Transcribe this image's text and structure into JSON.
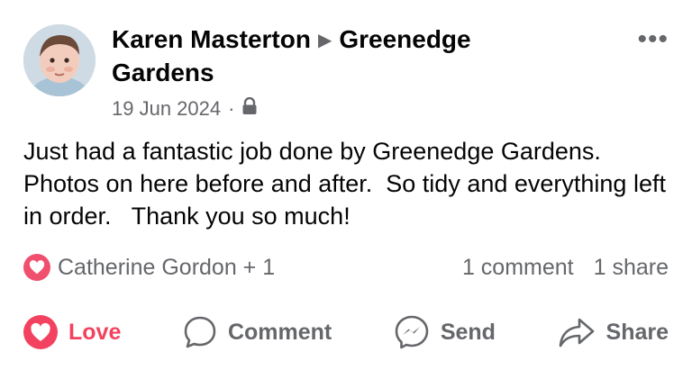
{
  "post": {
    "author": "Karen Masterton",
    "target": "Greenedge Gardens",
    "date": "19 Jun 2024",
    "separator": "·",
    "privacy_icon": "lock-icon",
    "more_icon": "ellipsis-icon",
    "more_label": "•••",
    "text": "Just had a fantastic job done by Greenedge Gardens.  Photos on here before and after.  So tidy and everything left in order.   Thank you so much!"
  },
  "reactions": {
    "icon": "heart-icon",
    "names": "Catherine Gordon + 1",
    "comments": "1 comment",
    "shares": "1 share"
  },
  "actions": [
    {
      "label": "Love",
      "icon": "heart-icon",
      "active": true
    },
    {
      "label": "Comment",
      "icon": "comment-icon",
      "active": false
    },
    {
      "label": "Send",
      "icon": "messenger-icon",
      "active": false
    },
    {
      "label": "Share",
      "icon": "share-icon",
      "active": false
    }
  ],
  "colors": {
    "love": "#f3425f",
    "secondary_text": "#65676b",
    "primary_text": "#050505"
  }
}
